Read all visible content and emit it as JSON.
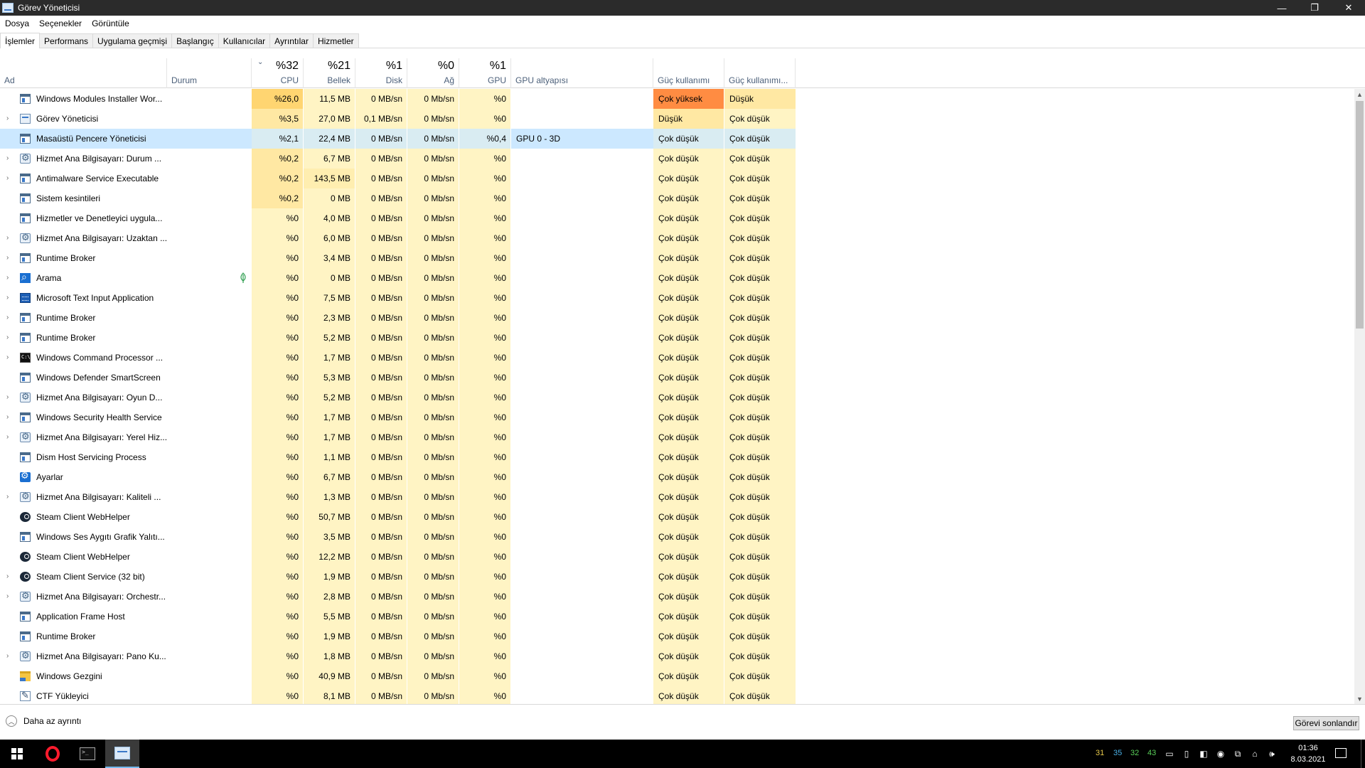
{
  "window": {
    "title": "Görev Yöneticisi",
    "minimize": "—",
    "restore": "❐",
    "close": "✕"
  },
  "menu": [
    "Dosya",
    "Seçenekler",
    "Görüntüle"
  ],
  "tabs": [
    "İşlemler",
    "Performans",
    "Uygulama geçmişi",
    "Başlangıç",
    "Kullanıcılar",
    "Ayrıntılar",
    "Hizmetler"
  ],
  "header": {
    "name": "Ad",
    "status": "Durum",
    "cpu": {
      "pct": "%32",
      "label": "CPU"
    },
    "mem": {
      "pct": "%21",
      "label": "Bellek"
    },
    "disk": {
      "pct": "%1",
      "label": "Disk"
    },
    "net": {
      "pct": "%0",
      "label": "Ağ"
    },
    "gpu": {
      "pct": "%1",
      "label": "GPU"
    },
    "gpu_engine": "GPU altyapısı",
    "power": "Güç kullanımı",
    "power_trend": "Güç kullanımı..."
  },
  "rows": [
    {
      "name": "Windows Modules Installer Wor...",
      "icon": "window-icon",
      "exp": false,
      "cpu": "%26,0",
      "mem": "11,5 MB",
      "disk": "0 MB/sn",
      "net": "0 Mb/sn",
      "gpu": "%0",
      "eng": "",
      "pow": "Çok yüksek",
      "powt": "Düşük"
    },
    {
      "name": "Görev Yöneticisi",
      "icon": "task-manager-icon",
      "exp": true,
      "cpu": "%3,5",
      "mem": "27,0 MB",
      "disk": "0,1 MB/sn",
      "net": "0 Mb/sn",
      "gpu": "%0",
      "eng": "",
      "pow": "Düşük",
      "powt": "Çok düşük"
    },
    {
      "name": "Masaüstü Pencere Yöneticisi",
      "icon": "window-icon",
      "exp": false,
      "cpu": "%2,1",
      "mem": "22,4 MB",
      "disk": "0 MB/sn",
      "net": "0 Mb/sn",
      "gpu": "%0,4",
      "eng": "GPU 0 - 3D",
      "pow": "Çok düşük",
      "powt": "Çok düşük"
    },
    {
      "name": "Hizmet Ana Bilgisayarı: Durum ...",
      "icon": "gear-icon",
      "exp": true,
      "cpu": "%0,2",
      "mem": "6,7 MB",
      "disk": "0 MB/sn",
      "net": "0 Mb/sn",
      "gpu": "%0",
      "eng": "",
      "pow": "Çok düşük",
      "powt": "Çok düşük"
    },
    {
      "name": "Antimalware Service Executable",
      "icon": "window-icon",
      "exp": true,
      "cpu": "%0,2",
      "mem": "143,5 MB",
      "disk": "0 MB/sn",
      "net": "0 Mb/sn",
      "gpu": "%0",
      "eng": "",
      "pow": "Çok düşük",
      "powt": "Çok düşük"
    },
    {
      "name": "Sistem kesintileri",
      "icon": "window-icon",
      "exp": false,
      "cpu": "%0,2",
      "mem": "0 MB",
      "disk": "0 MB/sn",
      "net": "0 Mb/sn",
      "gpu": "%0",
      "eng": "",
      "pow": "Çok düşük",
      "powt": "Çok düşük"
    },
    {
      "name": "Hizmetler ve Denetleyici uygula...",
      "icon": "window-icon",
      "exp": false,
      "cpu": "%0",
      "mem": "4,0 MB",
      "disk": "0 MB/sn",
      "net": "0 Mb/sn",
      "gpu": "%0",
      "eng": "",
      "pow": "Çok düşük",
      "powt": "Çok düşük"
    },
    {
      "name": "Hizmet Ana Bilgisayarı: Uzaktan ...",
      "icon": "gear-icon",
      "exp": true,
      "cpu": "%0",
      "mem": "6,0 MB",
      "disk": "0 MB/sn",
      "net": "0 Mb/sn",
      "gpu": "%0",
      "eng": "",
      "pow": "Çok düşük",
      "powt": "Çok düşük"
    },
    {
      "name": "Runtime Broker",
      "icon": "window-icon",
      "exp": true,
      "cpu": "%0",
      "mem": "3,4 MB",
      "disk": "0 MB/sn",
      "net": "0 Mb/sn",
      "gpu": "%0",
      "eng": "",
      "pow": "Çok düşük",
      "powt": "Çok düşük"
    },
    {
      "name": "Arama",
      "icon": "search-icon",
      "exp": true,
      "leaf": true,
      "cpu": "%0",
      "mem": "0 MB",
      "disk": "0 MB/sn",
      "net": "0 Mb/sn",
      "gpu": "%0",
      "eng": "",
      "pow": "Çok düşük",
      "powt": "Çok düşük"
    },
    {
      "name": "Microsoft Text Input Application",
      "icon": "keyboard-icon",
      "exp": true,
      "cpu": "%0",
      "mem": "7,5 MB",
      "disk": "0 MB/sn",
      "net": "0 Mb/sn",
      "gpu": "%0",
      "eng": "",
      "pow": "Çok düşük",
      "powt": "Çok düşük"
    },
    {
      "name": "Runtime Broker",
      "icon": "window-icon",
      "exp": true,
      "cpu": "%0",
      "mem": "2,3 MB",
      "disk": "0 MB/sn",
      "net": "0 Mb/sn",
      "gpu": "%0",
      "eng": "",
      "pow": "Çok düşük",
      "powt": "Çok düşük"
    },
    {
      "name": "Runtime Broker",
      "icon": "window-icon",
      "exp": true,
      "cpu": "%0",
      "mem": "5,2 MB",
      "disk": "0 MB/sn",
      "net": "0 Mb/sn",
      "gpu": "%0",
      "eng": "",
      "pow": "Çok düşük",
      "powt": "Çok düşük"
    },
    {
      "name": "Windows Command Processor ...",
      "icon": "command-prompt-icon",
      "exp": true,
      "cpu": "%0",
      "mem": "1,7 MB",
      "disk": "0 MB/sn",
      "net": "0 Mb/sn",
      "gpu": "%0",
      "eng": "",
      "pow": "Çok düşük",
      "powt": "Çok düşük"
    },
    {
      "name": "Windows Defender SmartScreen",
      "icon": "window-icon",
      "exp": false,
      "cpu": "%0",
      "mem": "5,3 MB",
      "disk": "0 MB/sn",
      "net": "0 Mb/sn",
      "gpu": "%0",
      "eng": "",
      "pow": "Çok düşük",
      "powt": "Çok düşük"
    },
    {
      "name": "Hizmet Ana Bilgisayarı: Oyun D...",
      "icon": "gear-icon",
      "exp": true,
      "cpu": "%0",
      "mem": "5,2 MB",
      "disk": "0 MB/sn",
      "net": "0 Mb/sn",
      "gpu": "%0",
      "eng": "",
      "pow": "Çok düşük",
      "powt": "Çok düşük"
    },
    {
      "name": "Windows Security Health Service",
      "icon": "window-icon",
      "exp": true,
      "cpu": "%0",
      "mem": "1,7 MB",
      "disk": "0 MB/sn",
      "net": "0 Mb/sn",
      "gpu": "%0",
      "eng": "",
      "pow": "Çok düşük",
      "powt": "Çok düşük"
    },
    {
      "name": "Hizmet Ana Bilgisayarı: Yerel Hiz...",
      "icon": "gear-icon",
      "exp": true,
      "cpu": "%0",
      "mem": "1,7 MB",
      "disk": "0 MB/sn",
      "net": "0 Mb/sn",
      "gpu": "%0",
      "eng": "",
      "pow": "Çok düşük",
      "powt": "Çok düşük"
    },
    {
      "name": "Dism Host Servicing Process",
      "icon": "window-icon",
      "exp": false,
      "cpu": "%0",
      "mem": "1,1 MB",
      "disk": "0 MB/sn",
      "net": "0 Mb/sn",
      "gpu": "%0",
      "eng": "",
      "pow": "Çok düşük",
      "powt": "Çok düşük"
    },
    {
      "name": "Ayarlar",
      "icon": "settings-icon",
      "exp": false,
      "cpu": "%0",
      "mem": "6,7 MB",
      "disk": "0 MB/sn",
      "net": "0 Mb/sn",
      "gpu": "%0",
      "eng": "",
      "pow": "Çok düşük",
      "powt": "Çok düşük"
    },
    {
      "name": "Hizmet Ana Bilgisayarı: Kaliteli ...",
      "icon": "gear-icon",
      "exp": true,
      "cpu": "%0",
      "mem": "1,3 MB",
      "disk": "0 MB/sn",
      "net": "0 Mb/sn",
      "gpu": "%0",
      "eng": "",
      "pow": "Çok düşük",
      "powt": "Çok düşük"
    },
    {
      "name": "Steam Client WebHelper",
      "icon": "steam-icon",
      "exp": false,
      "cpu": "%0",
      "mem": "50,7 MB",
      "disk": "0 MB/sn",
      "net": "0 Mb/sn",
      "gpu": "%0",
      "eng": "",
      "pow": "Çok düşük",
      "powt": "Çok düşük"
    },
    {
      "name": "Windows Ses Aygıtı Grafik Yalıtı...",
      "icon": "window-icon",
      "exp": false,
      "cpu": "%0",
      "mem": "3,5 MB",
      "disk": "0 MB/sn",
      "net": "0 Mb/sn",
      "gpu": "%0",
      "eng": "",
      "pow": "Çok düşük",
      "powt": "Çok düşük"
    },
    {
      "name": "Steam Client WebHelper",
      "icon": "steam-icon",
      "exp": false,
      "cpu": "%0",
      "mem": "12,2 MB",
      "disk": "0 MB/sn",
      "net": "0 Mb/sn",
      "gpu": "%0",
      "eng": "",
      "pow": "Çok düşük",
      "powt": "Çok düşük"
    },
    {
      "name": "Steam Client Service (32 bit)",
      "icon": "steam-icon",
      "exp": true,
      "cpu": "%0",
      "mem": "1,9 MB",
      "disk": "0 MB/sn",
      "net": "0 Mb/sn",
      "gpu": "%0",
      "eng": "",
      "pow": "Çok düşük",
      "powt": "Çok düşük"
    },
    {
      "name": "Hizmet Ana Bilgisayarı: Orchestr...",
      "icon": "gear-icon",
      "exp": true,
      "cpu": "%0",
      "mem": "2,8 MB",
      "disk": "0 MB/sn",
      "net": "0 Mb/sn",
      "gpu": "%0",
      "eng": "",
      "pow": "Çok düşük",
      "powt": "Çok düşük"
    },
    {
      "name": "Application Frame Host",
      "icon": "window-icon",
      "exp": false,
      "cpu": "%0",
      "mem": "5,5 MB",
      "disk": "0 MB/sn",
      "net": "0 Mb/sn",
      "gpu": "%0",
      "eng": "",
      "pow": "Çok düşük",
      "powt": "Çok düşük"
    },
    {
      "name": "Runtime Broker",
      "icon": "window-icon",
      "exp": false,
      "cpu": "%0",
      "mem": "1,9 MB",
      "disk": "0 MB/sn",
      "net": "0 Mb/sn",
      "gpu": "%0",
      "eng": "",
      "pow": "Çok düşük",
      "powt": "Çok düşük"
    },
    {
      "name": "Hizmet Ana Bilgisayarı: Pano Ku...",
      "icon": "gear-icon",
      "exp": true,
      "cpu": "%0",
      "mem": "1,8 MB",
      "disk": "0 MB/sn",
      "net": "0 Mb/sn",
      "gpu": "%0",
      "eng": "",
      "pow": "Çok düşük",
      "powt": "Çok düşük"
    },
    {
      "name": "Windows Gezgini",
      "icon": "folder-icon",
      "exp": false,
      "cpu": "%0",
      "mem": "40,9 MB",
      "disk": "0 MB/sn",
      "net": "0 Mb/sn",
      "gpu": "%0",
      "eng": "",
      "pow": "Çok düşük",
      "powt": "Çok düşük"
    },
    {
      "name": "CTF Yükleyici",
      "icon": "ctf-icon",
      "exp": false,
      "cpu": "%0",
      "mem": "8,1 MB",
      "disk": "0 MB/sn",
      "net": "0 Mb/sn",
      "gpu": "%0",
      "eng": "",
      "pow": "Çok düşük",
      "powt": "Çok düşük"
    }
  ],
  "selected_row": 2,
  "footer": {
    "less_details": "Daha az ayrıntı",
    "end_task": "Görevi sonlandır"
  },
  "taskbar": {
    "apps": [
      "opera-icon",
      "terminal-icon",
      "task-manager-icon"
    ],
    "tray_numbers": [
      {
        "value": "31",
        "color": "#e6c84a"
      },
      {
        "value": "35",
        "color": "#4ab0e6"
      },
      {
        "value": "32",
        "color": "#5ad15a"
      },
      {
        "value": "43",
        "color": "#5ad15a"
      }
    ],
    "time": "01:36",
    "date": "8.03.2021"
  },
  "colors": {
    "power_very_high": "#ff8c42",
    "heat_light": "#fff4c4",
    "heat_medium": "#ffe8a3",
    "heat_high": "#ffd571",
    "selected": "#cce8ff"
  }
}
